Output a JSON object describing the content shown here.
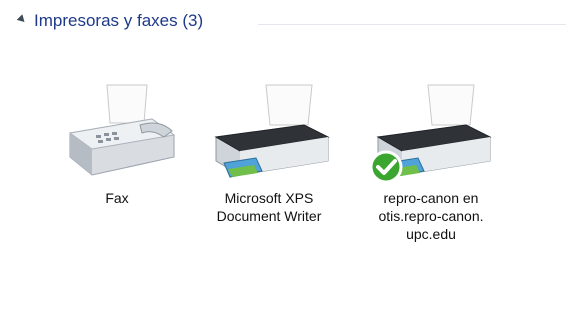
{
  "group": {
    "title": "Impresoras y faxes (3)"
  },
  "devices": [
    {
      "name": "fax",
      "label_lines": [
        "Fax"
      ],
      "icon": "fax-icon",
      "is_default": false
    },
    {
      "name": "microsoft-xps",
      "label_lines": [
        "Microsoft XPS",
        "Document Writer"
      ],
      "icon": "printer-icon",
      "is_default": false
    },
    {
      "name": "repro-canon",
      "label_lines": [
        "repro-canon en",
        "otis.repro-canon.",
        "upc.edu"
      ],
      "icon": "printer-icon",
      "is_default": true
    }
  ],
  "colors": {
    "group_title": "#1e3a8a",
    "default_check": "#3aa52f"
  }
}
